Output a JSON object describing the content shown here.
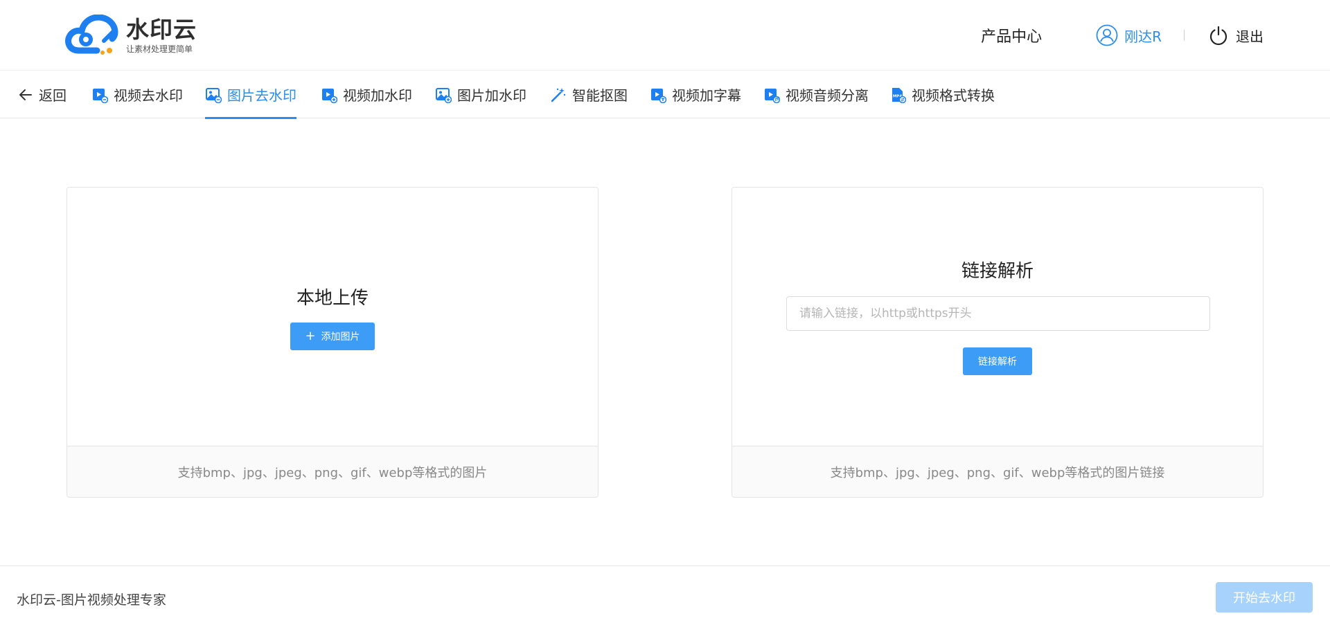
{
  "header": {
    "logo_name": "水印云",
    "logo_slogan": "让素材处理更简单",
    "product_center": "产品中心",
    "user_name": "刚达R",
    "logout_label": "退出"
  },
  "toolnav": {
    "back_label": "返回",
    "items": [
      {
        "label": "视频去水印",
        "icon": "video-icon"
      },
      {
        "label": "图片去水印",
        "icon": "image-icon",
        "active": true
      },
      {
        "label": "视频加水印",
        "icon": "video-add-icon"
      },
      {
        "label": "图片加水印",
        "icon": "image-add-icon"
      },
      {
        "label": "智能抠图",
        "icon": "magic-wand-icon"
      },
      {
        "label": "视频加字幕",
        "icon": "video-subtitle-icon"
      },
      {
        "label": "视频音频分离",
        "icon": "video-audio-icon"
      },
      {
        "label": "视频格式转换",
        "icon": "mp4-file-icon"
      }
    ]
  },
  "upload_card": {
    "title": "本地上传",
    "button_label": "添加图片",
    "footer": "支持bmp、jpg、jpeg、png、gif、webp等格式的图片"
  },
  "link_card": {
    "title": "链接解析",
    "input_placeholder": "请输入链接，以http或https开头",
    "input_value": "",
    "button_label": "链接解析",
    "footer": "支持bmp、jpg、jpeg、png、gif、webp等格式的图片链接"
  },
  "bottombar": {
    "left_text": "水印云-图片视频处理专家",
    "start_button": "开始去水印"
  },
  "colors": {
    "accent": "#2b8cf0",
    "button_primary": "#3d9cf5",
    "button_disabled": "#a6d2fb"
  }
}
